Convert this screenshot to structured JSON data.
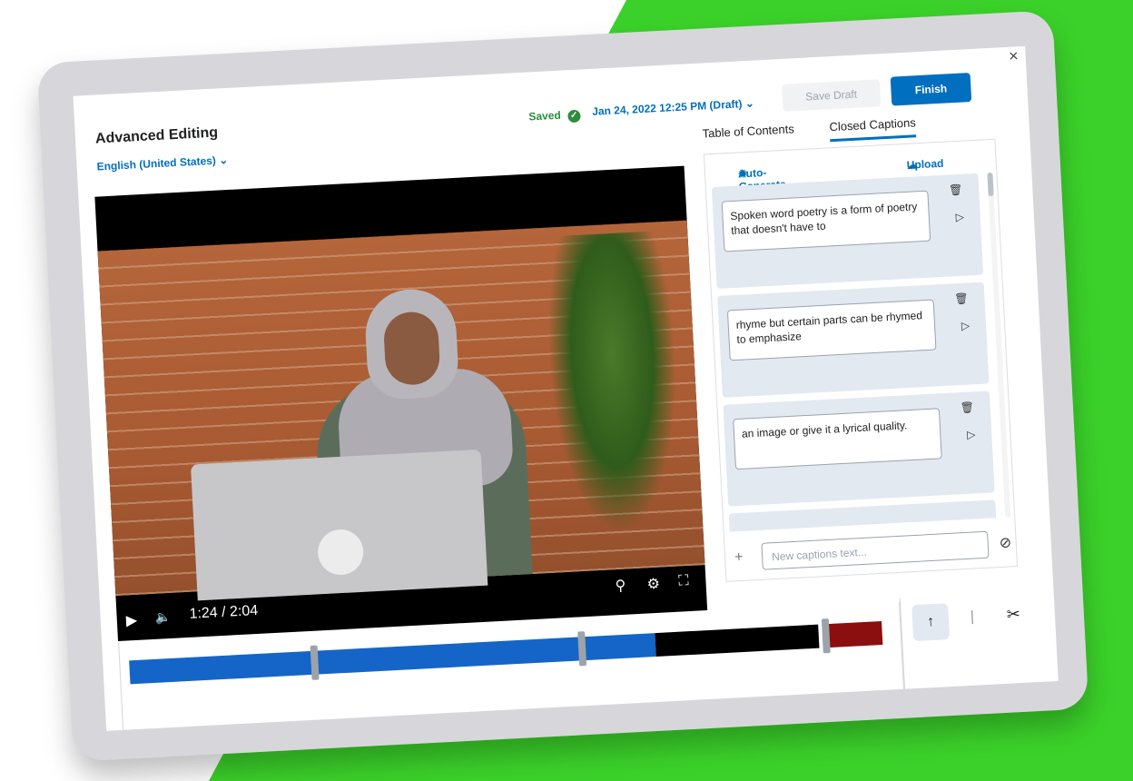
{
  "window": {
    "close_label": "×"
  },
  "header": {
    "title": "Advanced Editing",
    "language": "English (United States)",
    "saved_label": "Saved",
    "draft_date": "Jan 24, 2022 12:25 PM (Draft)",
    "save_draft_label": "Save Draft",
    "finish_label": "Finish"
  },
  "video": {
    "current_time": "1:24",
    "duration": "2:04",
    "time_display": "1:24 / 2:04"
  },
  "tabs": [
    {
      "label": "Table of Contents"
    },
    {
      "label": "Closed Captions"
    }
  ],
  "captions": {
    "auto_generate_label": "Auto-Generate",
    "upload_label": "Upload",
    "items": [
      {
        "text": "Spoken word poetry is a form of poetry that doesn't have to"
      },
      {
        "text": "rhyme but certain parts can be rhymed to emphasize"
      },
      {
        "text": "an image or give it a lyrical quality."
      }
    ],
    "new_placeholder": "New captions text..."
  },
  "colors": {
    "accent": "#006fbf",
    "saved_green": "#2c8d3b",
    "timeline_blue": "#1565c8",
    "timeline_red": "#8b0f0f",
    "background_green": "#3bd12a"
  },
  "icons": [
    "close-icon",
    "chevron-down-icon",
    "check-circle-icon",
    "play-icon",
    "volume-icon",
    "search-icon",
    "gear-icon",
    "fullscreen-icon",
    "auto-generate-icon",
    "upload-icon",
    "trash-icon",
    "play-caption-icon",
    "plus-icon",
    "cancel-icon",
    "arrow-up-icon",
    "scissors-icon"
  ]
}
